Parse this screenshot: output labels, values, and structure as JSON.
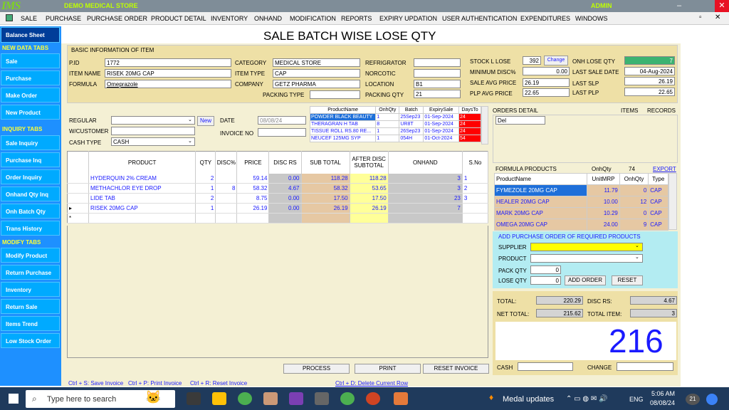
{
  "app": {
    "logo": "IMS",
    "store": "DEMO MEDICAL STORE",
    "user": "ADMIN",
    "close": "✕",
    "minimize": "–",
    "maximize": "▫",
    "close_small": "✕"
  },
  "menu": [
    "SALE",
    "PURCHASE",
    "PURCHASE ORDER",
    "PRODUCT DETAIL",
    "INVENTORY",
    "ONHAND",
    "MODIFICATION",
    "REPORTS",
    "EXPIRY UPDATION",
    "USER AUTHENTICATION",
    "EXPENDITURES",
    "WINDOWS"
  ],
  "sidebar": {
    "balance": "Balance Sheet",
    "h1": "NEW DATA TABS",
    "new": [
      "Sale",
      "Purchase",
      "Make Order",
      "New Product"
    ],
    "h2": "INQUIRY TABS",
    "inq": [
      "Sale Inquiry",
      "Purchase Inq",
      "Order Inquiry",
      "Onhand Qty Inq",
      "Onh Batch Qty",
      "Trans History"
    ],
    "h3": "MODIFY TABS",
    "mod": [
      "Modify Product",
      "Return Purchase",
      "Inventory",
      "Return Sale",
      "Items Trend",
      "Low Stock Order"
    ]
  },
  "title": "SALE BATCH WISE LOSE QTY",
  "basic": {
    "header": "BASIC INFORMATION OF ITEM",
    "pid_l": "P.ID",
    "pid": "1772",
    "item_l": "ITEM NAME",
    "item": "RISEK 20MG CAP",
    "formula_l": "FORMULA",
    "formula": "Omeprazole",
    "cat_l": "CATEGORY",
    "cat": "MEDICAL STORE",
    "type_l": "ITEM TYPE",
    "type": "CAP",
    "comp_l": "COMPANY",
    "comp": "GETZ PHARMA",
    "pack_l": "PACKING TYPE",
    "pack": "",
    "ref_l": "REFRIGRATOR",
    "ref": "",
    "nor_l": "NORCOTIC",
    "nor": "",
    "loc_l": "LOCATION",
    "loc": "B1",
    "pq_l": "PACKING QTY",
    "pq": "21",
    "sll_l": "STOCK L LOSE",
    "sll": "392",
    "change": "Change",
    "min_l": "MINIMUM DISC%",
    "min": "0.00",
    "sap_l": "SALE AVG PRICE",
    "sap": "26.19",
    "plp_l": "PLP AVG PRICE",
    "plp": "22.65",
    "onh_l": "ONH LOSE QTY",
    "onh": "7",
    "lsd_l": "LAST SALE DATE",
    "lsd": "04-Aug-2024",
    "lslp_l": "LAST SLP",
    "lslp": "26.19",
    "lplp_l": "LAST PLP",
    "lplp": "22.65"
  },
  "form": {
    "regular": "REGULAR",
    "new": "New",
    "wcust": "W/CUSTOMER",
    "ctype": "CASH TYPE",
    "ctype_v": "CASH",
    "date_l": "DATE",
    "date": "08/08/24",
    "inv_l": "INVOICE NO"
  },
  "batch": {
    "headers": [
      "ProductName",
      "OnhQty",
      "Batch",
      "ExpirySale",
      "DaysTo"
    ],
    "rows": [
      [
        "POWDER BLACK BEAUTY",
        "1",
        "25Sep23",
        "01-Sep-2024",
        "24"
      ],
      [
        "THERAGRAN H TAB",
        "8",
        "UR8T",
        "01-Sep-2024",
        "24"
      ],
      [
        "TISSUE ROLL RS.80 RE...",
        "1",
        "26Sep23",
        "01-Sep-2024",
        "24"
      ],
      [
        "NEUCEF 125MG SYP",
        "1",
        "054H",
        "01-Oct-2024",
        "54"
      ]
    ]
  },
  "orders": {
    "l": "ORDERS DETAIL",
    "items": "ITEMS",
    "records": "RECORDS",
    "del": "Del"
  },
  "grid": {
    "headers": [
      "PRODUCT",
      "QTY",
      "DISC%",
      "PRICE",
      "DISC RS",
      "SUB TOTAL",
      "AFTER DISC SUBTOTAL",
      "ONHAND",
      "S.No"
    ],
    "rows": [
      [
        "HYDERQUIN 2% CREAM",
        "2",
        "",
        "59.14",
        "0.00",
        "118.28",
        "118.28",
        "3",
        "1"
      ],
      [
        "METHACHLOR EYE DROP",
        "1",
        "8",
        "58.32",
        "4.67",
        "58.32",
        "53.65",
        "3",
        "2"
      ],
      [
        "LIDE TAB",
        "2",
        "",
        "8.75",
        "0.00",
        "17.50",
        "17.50",
        "23",
        "3"
      ],
      [
        "RISEK 20MG CAP",
        "1",
        "",
        "26.19",
        "0.00",
        "26.19",
        "26.19",
        "7",
        ""
      ]
    ],
    "sel": "▸",
    "star": "*"
  },
  "formula_products": {
    "l": "FORMULA PRODUCTS",
    "onh_l": "OnhQty",
    "onh": "74",
    "export": "EXPORT",
    "headers": [
      "ProductName",
      "UnitMRP",
      "OnhQty",
      "Type"
    ],
    "rows": [
      [
        "FYMEZOLE 20MG CAP",
        "11.79",
        "0",
        "CAP"
      ],
      [
        "HEALER 20MG CAP",
        "10.00",
        "12",
        "CAP"
      ],
      [
        "MARK 20MG CAP",
        "10.29",
        "0",
        "CAP"
      ],
      [
        "OMEGA 20MG CAP",
        "24.00",
        "9",
        "CAP"
      ]
    ]
  },
  "po": {
    "header": "ADD PURCHASE ORDER OF REQUIRED PRODUCTS",
    "supplier": "SUPPLIER",
    "product": "PRODUCT",
    "pack": "PACK QTY",
    "pack_v": "0",
    "lose": "LOSE QTY",
    "lose_v": "0",
    "add": "ADD ORDER",
    "reset": "RESET"
  },
  "totals": {
    "total_l": "TOTAL:",
    "total": "220.29",
    "discrs_l": "DISC RS:",
    "discrs": "4.67",
    "net_l": "NET TOTAL:",
    "net": "215.62",
    "ti_l": "TOTAL ITEM:",
    "ti": "3",
    "big": "216",
    "cash": "CASH",
    "change": "CHANGE"
  },
  "buttons": {
    "process": "PROCESS",
    "print": "PRINT",
    "reset": "RESET INVOICE"
  },
  "shortcuts": {
    "s1": "Ctrl + S: Save Invoice",
    "s2": "Ctrl + P: Print Invoice",
    "s3": "Ctrl + R: Reset Invoice",
    "s4": "Ctrl + D: Delete Current Row"
  },
  "taskbar": {
    "search": "Type here to search",
    "medal": "Medal updates",
    "lang": "ENG",
    "time": "5:06 AM",
    "date": "08/08/24",
    "notif": "21"
  }
}
